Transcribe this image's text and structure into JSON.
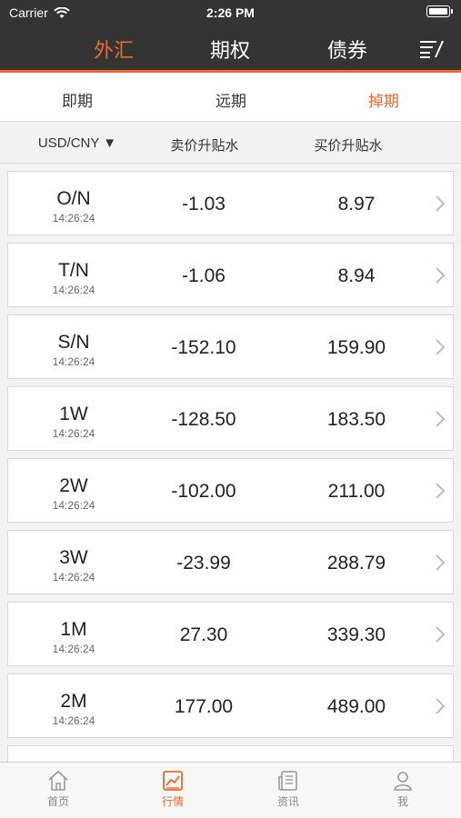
{
  "status_bar": {
    "carrier": "Carrier",
    "time": "2:26 PM"
  },
  "top_tabs": [
    {
      "label": "外汇",
      "active": true
    },
    {
      "label": "期权",
      "active": false
    },
    {
      "label": "债券",
      "active": false
    }
  ],
  "sub_tabs": [
    {
      "label": "即期",
      "active": false
    },
    {
      "label": "远期",
      "active": false
    },
    {
      "label": "掉期",
      "active": true
    }
  ],
  "columns": {
    "pair": "USD/CNY ▼",
    "sell": "卖价升贴水",
    "buy": "买价升贴水"
  },
  "rows": [
    {
      "tenor": "O/N",
      "time": "14:26:24",
      "sell": "-1.03",
      "buy": "8.97"
    },
    {
      "tenor": "T/N",
      "time": "14:26:24",
      "sell": "-1.06",
      "buy": "8.94"
    },
    {
      "tenor": "S/N",
      "time": "14:26:24",
      "sell": "-152.10",
      "buy": "159.90"
    },
    {
      "tenor": "1W",
      "time": "14:26:24",
      "sell": "-128.50",
      "buy": "183.50"
    },
    {
      "tenor": "2W",
      "time": "14:26:24",
      "sell": "-102.00",
      "buy": "211.00"
    },
    {
      "tenor": "3W",
      "time": "14:26:24",
      "sell": "-23.99",
      "buy": "288.79"
    },
    {
      "tenor": "1M",
      "time": "14:26:24",
      "sell": "27.30",
      "buy": "339.30"
    },
    {
      "tenor": "2M",
      "time": "14:26:24",
      "sell": "177.00",
      "buy": "489.00"
    }
  ],
  "bottom_tabs": [
    {
      "label": "首页",
      "icon": "home-icon",
      "active": false
    },
    {
      "label": "行情",
      "icon": "market-chart-icon",
      "active": true
    },
    {
      "label": "资讯",
      "icon": "news-icon",
      "active": false
    },
    {
      "label": "我",
      "icon": "user-icon",
      "active": false
    }
  ],
  "colors": {
    "accent": "#ec6a2a",
    "header_bg": "#343434"
  }
}
